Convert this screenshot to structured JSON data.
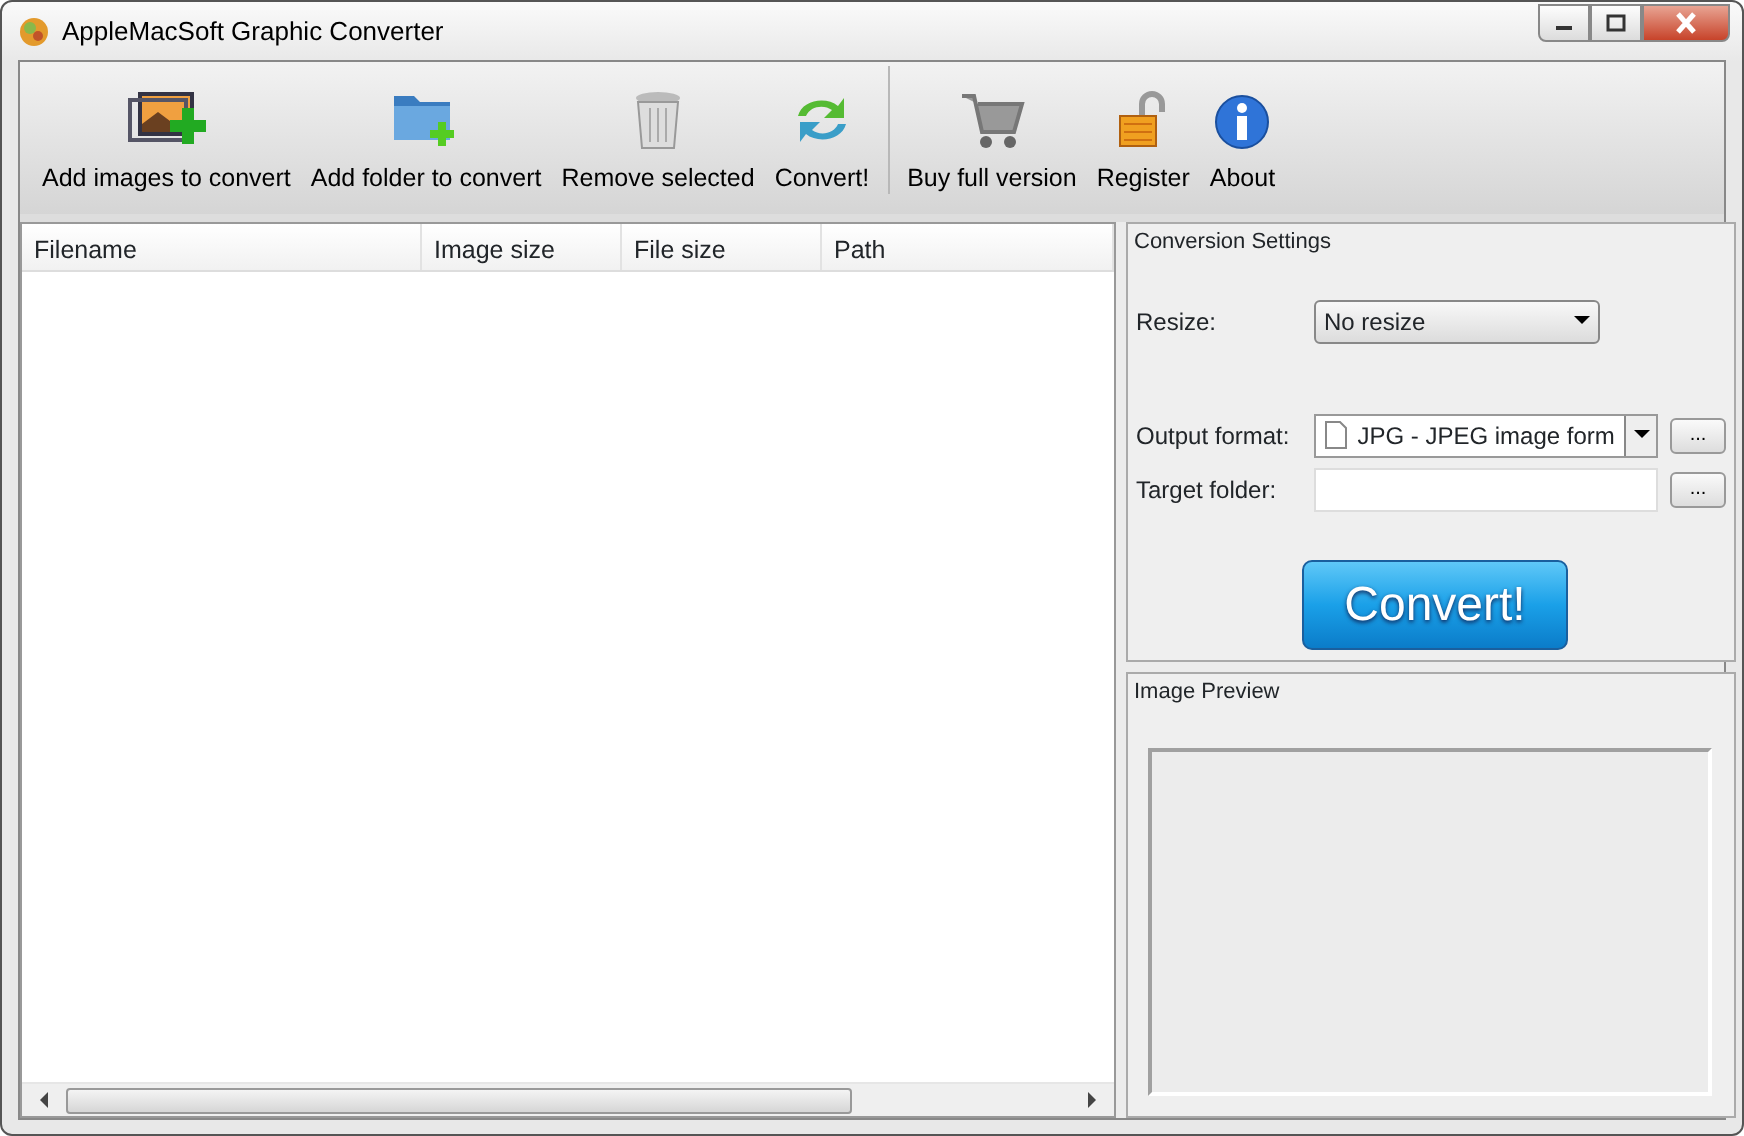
{
  "window": {
    "title": "AppleMacSoft Graphic Converter"
  },
  "toolbar": [
    {
      "label": "Add images to convert",
      "kind": "images"
    },
    {
      "label": "Add folder to convert",
      "kind": "folder"
    },
    {
      "label": "Remove selected",
      "kind": "trash"
    },
    {
      "label": "Convert!",
      "kind": "convert"
    },
    {
      "label": "Buy full version",
      "kind": "cart",
      "separator_before": true
    },
    {
      "label": "Register",
      "kind": "lock"
    },
    {
      "label": "About",
      "kind": "info"
    }
  ],
  "table": {
    "columns": [
      "Filename",
      "Image size",
      "File size",
      "Path"
    ]
  },
  "conversion_settings": {
    "title": "Conversion Settings",
    "resize": {
      "label": "Resize:",
      "value": "No resize"
    },
    "output_format": {
      "label": "Output format:",
      "value": "JPG - JPEG image form",
      "browse": "..."
    },
    "target_folder": {
      "label": "Target folder:",
      "browse": "..."
    },
    "convert_button": "Convert!"
  },
  "image_preview": {
    "title": "Image Preview"
  }
}
